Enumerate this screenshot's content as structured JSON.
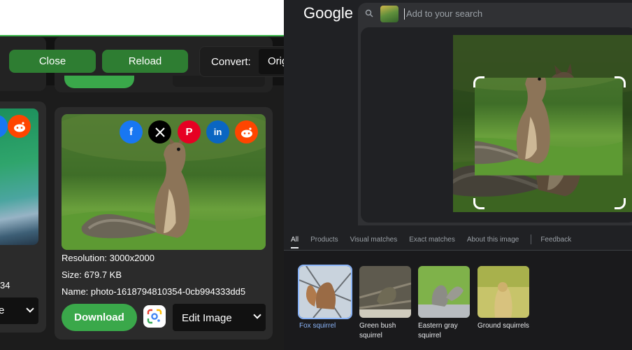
{
  "left_panel": {
    "toolbar": {
      "close_label": "Close",
      "reload_label": "Reload",
      "convert_label": "Convert:",
      "convert_value": "Orig"
    },
    "left_card": {
      "info_fragment": "34",
      "select_value": "e"
    },
    "main_card": {
      "share_buttons": [
        "facebook",
        "x",
        "pinterest",
        "linkedin",
        "reddit"
      ],
      "resolution": "Resolution: 3000x2000",
      "size": "Size: 679.7 KB",
      "name": "Name: photo-1618794810354-0cb994333dd5",
      "download_label": "Download",
      "edit_select_value": "Edit Image"
    },
    "colors": {
      "accent_green": "#3aa84a",
      "dark_green": "#2e7d32"
    }
  },
  "right_panel": {
    "logo_text": "Google",
    "search_placeholder": "Add to your search",
    "tabs": [
      "All",
      "Products",
      "Visual matches",
      "Exact matches",
      "About this image",
      "Feedback"
    ],
    "active_tab": "All",
    "matches": [
      {
        "label": "Fox squirrel",
        "selected": true
      },
      {
        "label": "Green bush squirrel",
        "selected": false
      },
      {
        "label": "Eastern gray squirrel",
        "selected": false
      },
      {
        "label": "Ground squirrels",
        "selected": false
      }
    ],
    "colors": {
      "link_blue": "#8ab4f8"
    }
  }
}
